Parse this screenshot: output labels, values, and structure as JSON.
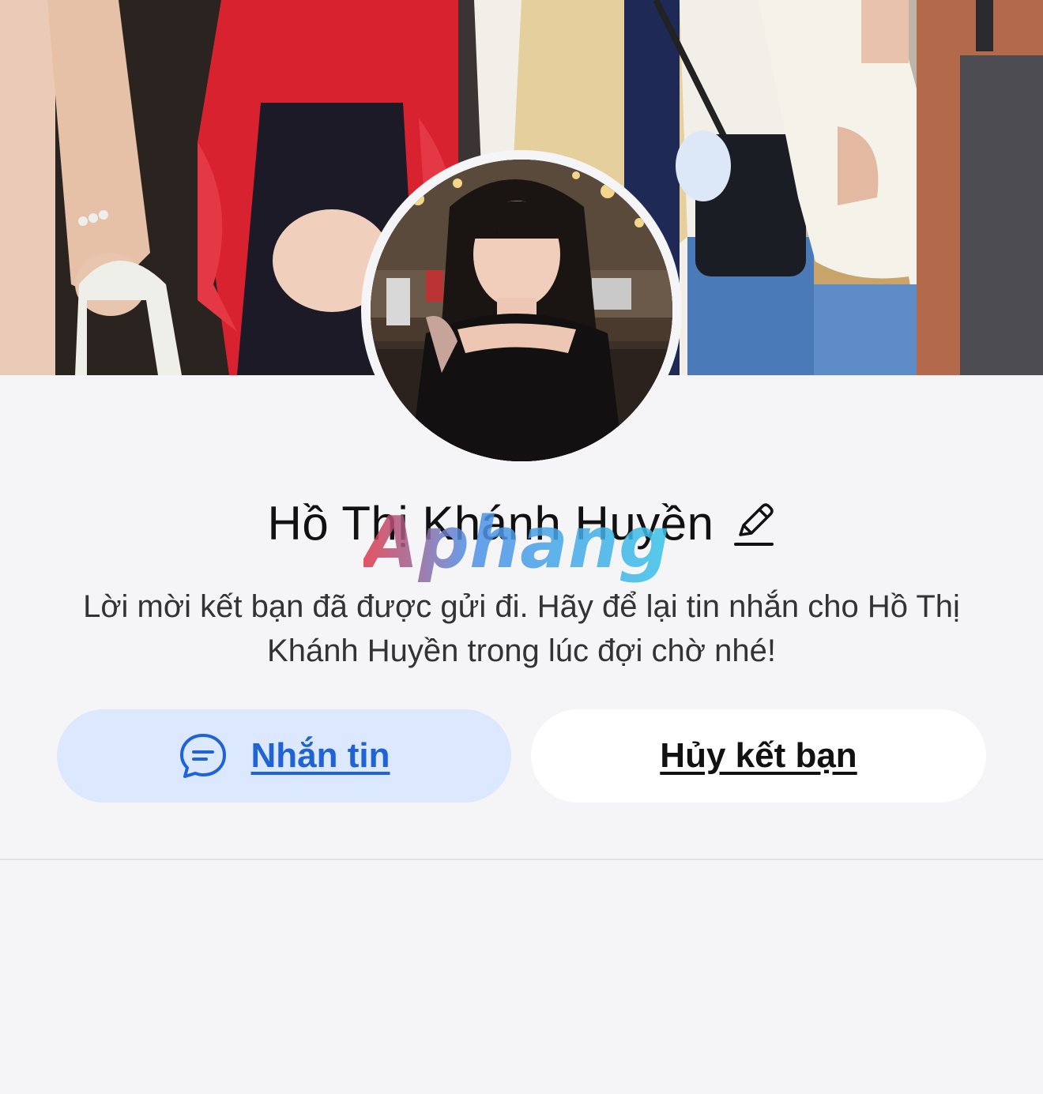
{
  "profile": {
    "name": "Hồ Thị Khánh Huyền",
    "message": "Lời mời kết bạn đã được gửi đi. Hãy để lại tin nhắn cho Hồ Thị Khánh Huyền trong lúc đợi chờ nhé!"
  },
  "actions": {
    "message_label": "Nhắn tin",
    "unfriend_label": "Hủy kết bạn"
  },
  "watermark": {
    "text": "Aphang"
  },
  "icons": {
    "edit": "pencil-icon",
    "message": "chat-bubble-icon"
  },
  "colors": {
    "background": "#f5f5f8",
    "message_button_bg": "#dce8fd",
    "message_button_text": "#1f63d6",
    "unfriend_button_bg": "#ffffff",
    "text_primary": "#111111"
  }
}
